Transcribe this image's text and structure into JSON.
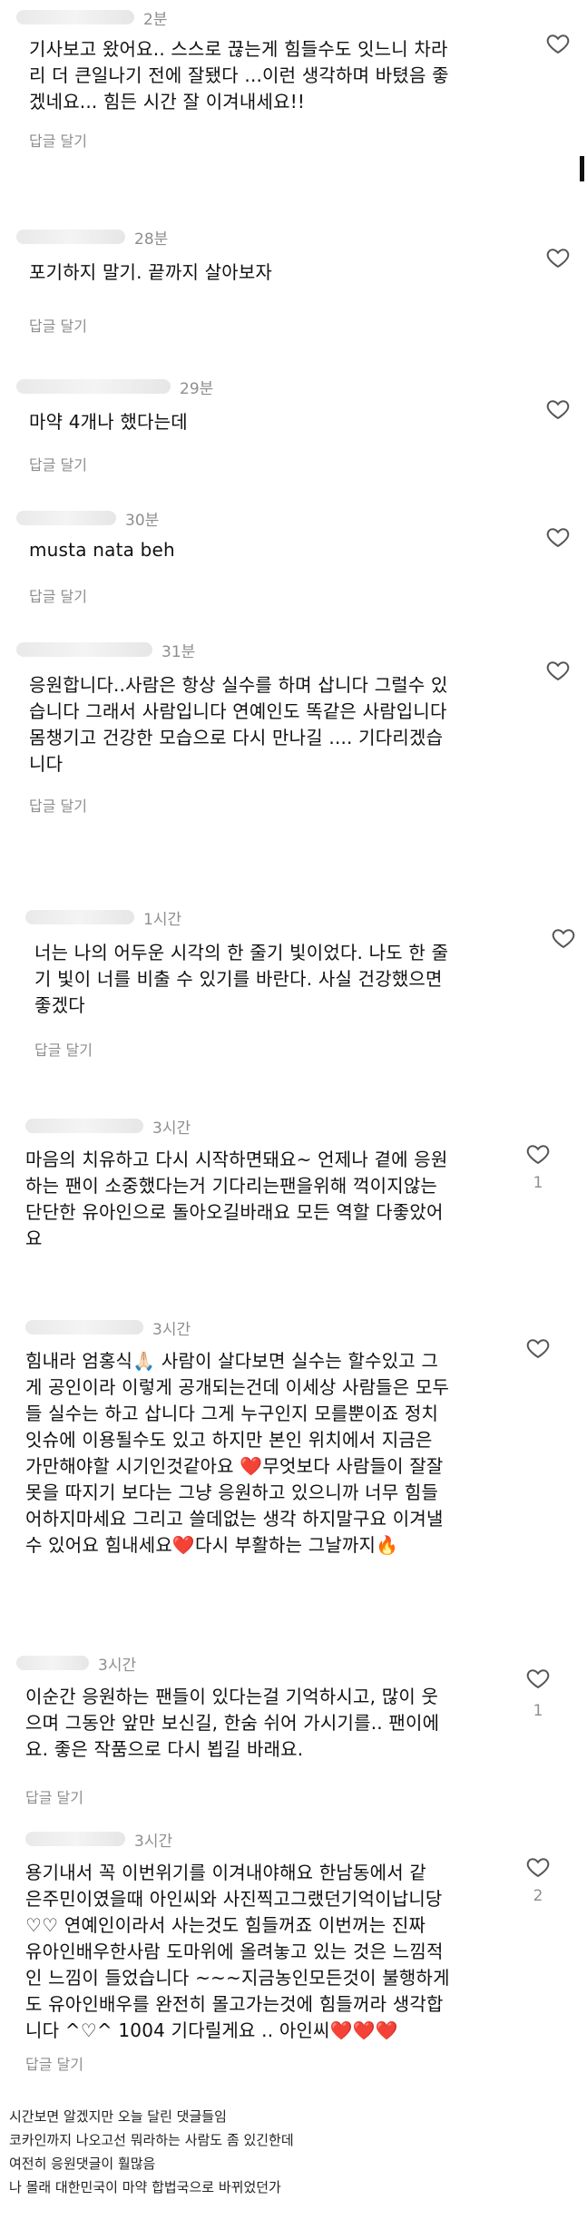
{
  "comments": [
    {
      "time": "2분",
      "text": "기사보고 왔어요.. 스스로 끊는게 힘들수도 잇느니 차라\n리 더 큰일나기 전에 잘됐다 ...이런 생각하며 바텼음 좋\n겠네요... 힘든 시간 잘 이겨내세요!!",
      "reply": "답글 달기",
      "likes": ""
    },
    {
      "time": "28분",
      "text": "포기하지 말기. 끝까지 살아보자",
      "reply": "답글 달기",
      "likes": ""
    },
    {
      "time": "29분",
      "text": "마약 4개나 했다는데",
      "reply": "답글 달기",
      "likes": ""
    },
    {
      "time": "30분",
      "text": "musta nata beh",
      "reply": "답글 달기",
      "likes": ""
    },
    {
      "time": "31분",
      "text": "응원합니다..사람은 항상 실수를 하며 삽니다 그럴수 있\n습니다 그래서 사람입니다 연예인도 똑같은 사람입니다\n몸챙기고 건강한 모습으로 다시 만나길 .... 기다리겠습\n니다",
      "reply": "답글 달기",
      "likes": ""
    },
    {
      "time": "1시간",
      "text": "너는 나의 어두운 시각의 한 줄기 빛이었다. 나도 한 줄\n기 빛이 너를 비출 수 있기를 바란다. 사실 건강했으면\n좋겠다",
      "reply": "답글 달기",
      "likes": ""
    },
    {
      "time": "3시간",
      "text": "마음의 치유하고 다시 시작하면돼요~ 언제나 곁에 응원\n하는 팬이 소중했다는거 기다리는팬을위해 꺽이지않는\n단단한 유아인으로 돌아오길바래요 모든 역할 다좋았어\n요",
      "reply": "",
      "likes": "1"
    },
    {
      "time": "3시간",
      "text": "힘내라 엄홍식🙏🏻 사람이 살다보면 실수는 할수있고 그\n게 공인이라 이렇게 공개되는건데 이세상 사람들은 모두\n들 실수는 하고 삽니다 그게 누구인지 모를뿐이죠 정치\n잇슈에 이용될수도 있고 하지만 본인 위치에서 지금은\n가만해야할 시기인것같아요 ❤️무엇보다 사람들이 잘잘\n못을 따지기 보다는 그냥 응원하고 있으니까 너무 힘들\n어하지마세요 그리고 쓸데없는 생각 하지말구요 이겨낼\n수 있어요 힘내세요❤️다시 부활하는 그날까지🔥",
      "reply": "",
      "likes": ""
    },
    {
      "time": "3시간",
      "text": "이순간 응원하는 팬들이 있다는걸 기억하시고, 많이 웃\n으며 그동안 앞만 보신길, 한숨 쉬어 가시기를.. 팬이에\n요. 좋은 작품으로 다시 뵙길 바래요.",
      "reply": "답글 달기",
      "likes": "1"
    },
    {
      "time": "3시간",
      "text": "용기내서 꼭 이번위기를 이겨내야해요 한남동에서 같\n은주민이였을때 아인씨와 사진찍고그랬던기억이납니당\n♡♡ 연예인이라서 사는것도 힘들꺼죠 이번꺼는 진짜\n유아인배우한사람 도마위에 올려놓고 있는 것은 느낌적\n인 느낌이 들었습니다 ~~~지금농인모든것이 불행하게\n도 유아인배우를 완전히 몰고가는것에 힘들꺼라 생각합\n니다 ^♡^ 1004 기다릴게요 .. 아인씨❤️❤️❤️",
      "reply": "답글 달기",
      "likes": "2"
    }
  ],
  "footer": {
    "lines": [
      "시간보면 알겠지만 오늘 달린 댓글들임",
      "코카인까지 나오고선 뭐라하는 사람도 좀 있긴한데",
      "여전히 응원댓글이 훨많음",
      "나 몰래 대한민국이 마약 합법국으로 바뀌었던가"
    ]
  },
  "icons": {
    "like": "heart-outline-icon"
  },
  "colors": {
    "muted": "#8e8e8e",
    "text": "#111111",
    "background": "#ffffff"
  }
}
